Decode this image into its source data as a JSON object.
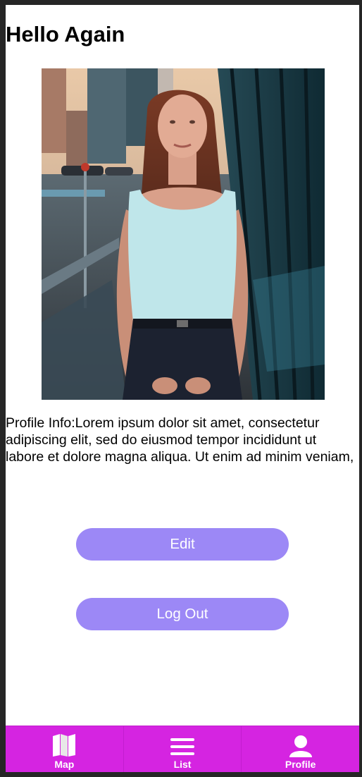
{
  "page": {
    "title": "Hello Again",
    "photo_alt": "profile-photo",
    "profile_info": "Profile Info:Lorem ipsum dolor sit amet, consectetur adipiscing elit, sed do eiusmod tempor incididunt ut labore et dolore magna aliqua. Ut enim ad minim veniam,"
  },
  "buttons": {
    "edit_label": "Edit",
    "logout_label": "Log Out"
  },
  "tabbar": {
    "tabs": [
      {
        "label": "Map",
        "icon": "map-icon"
      },
      {
        "label": "List",
        "icon": "list-icon"
      },
      {
        "label": "Profile",
        "icon": "profile-icon"
      }
    ]
  },
  "colors": {
    "accent_button": "#9c88f6",
    "tabbar_bg": "#d524e1",
    "frame_bg": "#262626"
  }
}
